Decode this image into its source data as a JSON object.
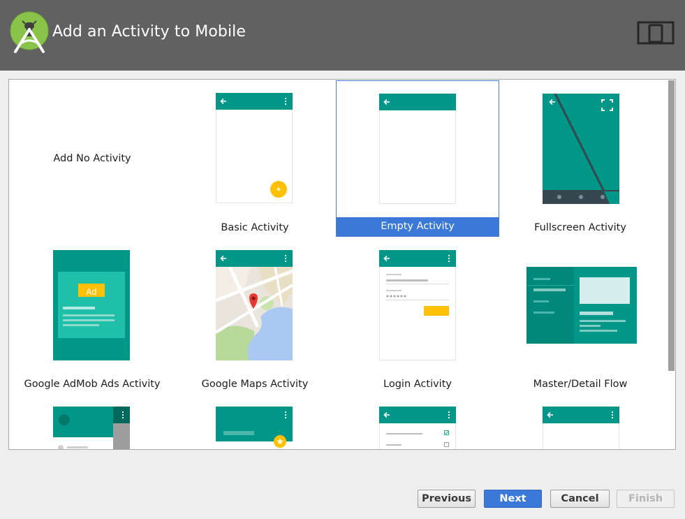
{
  "window": {
    "title": "Add an Activity to Mobile"
  },
  "gallery": {
    "items": [
      {
        "label": "Add No Activity"
      },
      {
        "label": "Basic Activity"
      },
      {
        "label": "Empty Activity"
      },
      {
        "label": "Fullscreen Activity"
      },
      {
        "label": "Google AdMob Ads Activity",
        "ad_badge": "Ad"
      },
      {
        "label": "Google Maps Activity"
      },
      {
        "label": "Login Activity"
      },
      {
        "label": "Master/Detail Flow"
      }
    ],
    "selected": "Empty Activity"
  },
  "buttons": {
    "previous": "Previous",
    "next": "Next",
    "cancel": "Cancel",
    "finish": "Finish"
  },
  "colors": {
    "teal": "#009688",
    "teal_dark": "#00796b",
    "selection": "#3b79d8",
    "fab": "#ffc107",
    "header": "#616161"
  }
}
